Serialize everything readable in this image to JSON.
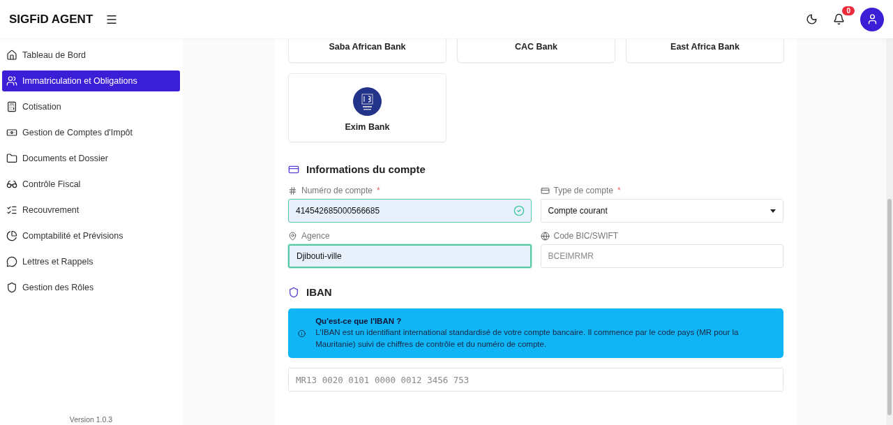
{
  "header": {
    "brand": "SIGFiD AGENT",
    "notifications": {
      "count": "0"
    }
  },
  "sidebar": {
    "items": [
      {
        "label": "Tableau de Bord",
        "selected": false
      },
      {
        "label": "Immatriculation et Obligations",
        "selected": true
      },
      {
        "label": "Cotisation",
        "selected": false
      },
      {
        "label": "Gestion de Comptes d'Impôt",
        "selected": false
      },
      {
        "label": "Documents et Dossier",
        "selected": false
      },
      {
        "label": "Contrôle Fiscal",
        "selected": false
      },
      {
        "label": "Recouvrement",
        "selected": false
      },
      {
        "label": "Comptabilité et Prévisions",
        "selected": false
      },
      {
        "label": "Lettres et Rappels",
        "selected": false
      },
      {
        "label": "Gestion des Rôles",
        "selected": false
      }
    ],
    "version": "Version 1.0.3"
  },
  "banks": [
    {
      "name": "Saba African Bank",
      "logo": false
    },
    {
      "name": "CAC Bank",
      "logo": false
    },
    {
      "name": "East Africa Bank",
      "logo": false
    },
    {
      "name": "Exim Bank",
      "logo": true
    }
  ],
  "account_info": {
    "title": "Informations du compte",
    "fields": [
      {
        "label": "Numéro de compte",
        "required_mark": "*",
        "kind": "text",
        "validated": true,
        "focused": false,
        "value": "414542685000566685"
      },
      {
        "label": "Type de compte",
        "required_mark": "*",
        "kind": "select",
        "validated": false,
        "focused": false,
        "value": "Compte courant"
      },
      {
        "label": "Agence",
        "kind": "text",
        "validated": false,
        "focused": true,
        "value": "Djibouti-ville"
      },
      {
        "label": "Code BIC/SWIFT",
        "kind": "text",
        "validated": false,
        "focused": false,
        "placeholder": "BCEIMRMR"
      }
    ]
  },
  "iban": {
    "title": "IBAN",
    "info": {
      "title": "Qu'est-ce que l'IBAN ?",
      "text": "L'IBAN est un identifiant international standardisé de votre compte bancaire. Il commence par le code pays (MR pour la Mauritanie) suivi de chiffres de contrôle et du numéro de compte."
    },
    "field": {
      "placeholder": "MR13 0020 0101 0000 0012 3456 753"
    }
  }
}
